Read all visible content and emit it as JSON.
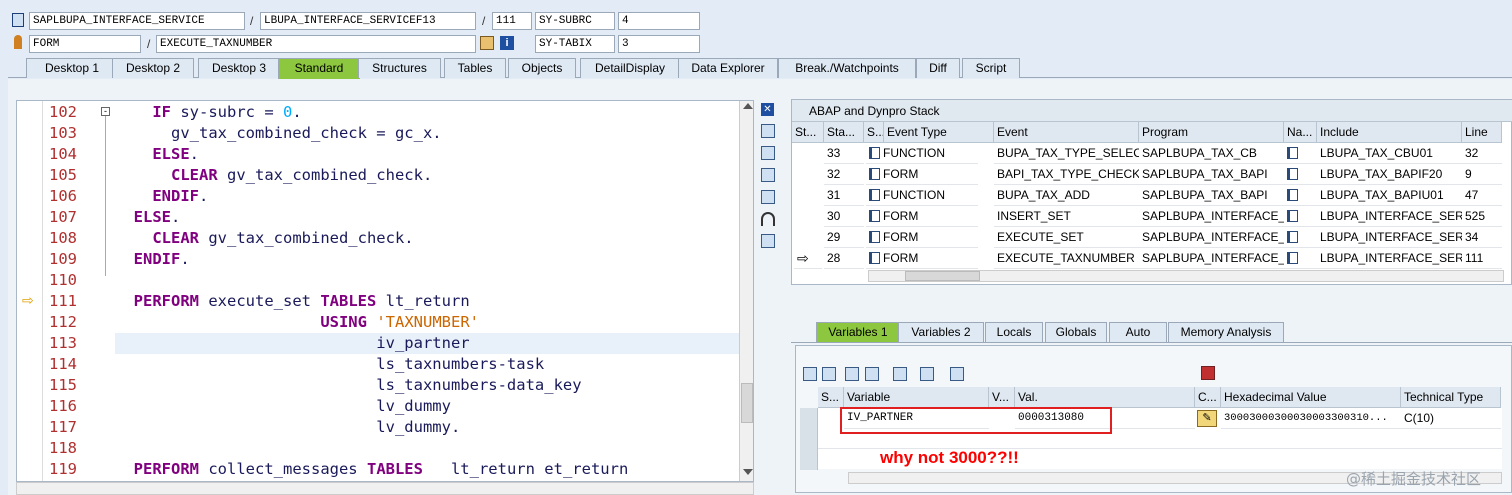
{
  "header": {
    "program_field": "SAPLBUPA_INTERFACE_SERVICE",
    "include_field": "LBUPA_INTERFACE_SERVICEF13",
    "line_field": "111",
    "sysvar1_name": "SY-SUBRC",
    "sysvar1_value": "4",
    "event_type_field": "FORM",
    "event_field": "EXECUTE_TAXNUMBER",
    "sysvar2_name": "SY-TABIX",
    "sysvar2_value": "3",
    "slash1": "/",
    "slash2": "/",
    "slash3": "/"
  },
  "tabs": [
    "Desktop 1",
    "Desktop 2",
    "Desktop 3",
    "Standard",
    "Structures",
    "Tables",
    "Objects",
    "DetailDisplay",
    "Data Explorer",
    "Break./Watchpoints",
    "Diff",
    "Script"
  ],
  "code": {
    "line_numbers": [
      "102",
      "103",
      "104",
      "105",
      "106",
      "107",
      "108",
      "109",
      "110",
      "111",
      "112",
      "113",
      "114",
      "115",
      "116",
      "117",
      "118",
      "119"
    ],
    "current_line_marker": "⇨"
  },
  "stack": {
    "title": "ABAP and Dynpro Stack",
    "columns": [
      "St...",
      "Sta...",
      "S...",
      "Event Type",
      "Event",
      "Program",
      "Na...",
      "Include",
      "Line"
    ],
    "rows": [
      {
        "stack": "33",
        "event_type": "FUNCTION",
        "event": "BUPA_TAX_TYPE_SELEC...",
        "program": "SAPLBUPA_TAX_CB",
        "include": "LBUPA_TAX_CBU01",
        "line": "32"
      },
      {
        "stack": "32",
        "event_type": "FORM",
        "event": "BAPI_TAX_TYPE_CHECK",
        "program": "SAPLBUPA_TAX_BAPI",
        "include": "LBUPA_TAX_BAPIF20",
        "line": "9"
      },
      {
        "stack": "31",
        "event_type": "FUNCTION",
        "event": "BUPA_TAX_ADD",
        "program": "SAPLBUPA_TAX_BAPI",
        "include": "LBUPA_TAX_BAPIU01",
        "line": "47"
      },
      {
        "stack": "30",
        "event_type": "FORM",
        "event": "INSERT_SET",
        "program": "SAPLBUPA_INTERFACE_...",
        "include": "LBUPA_INTERFACE_SER...",
        "line": "525"
      },
      {
        "stack": "29",
        "event_type": "FORM",
        "event": "EXECUTE_SET",
        "program": "SAPLBUPA_INTERFACE_...",
        "include": "LBUPA_INTERFACE_SER...",
        "line": "34"
      },
      {
        "stack": "28",
        "event_type": "FORM",
        "event": "EXECUTE_TAXNUMBER",
        "program": "SAPLBUPA_INTERFACE_...",
        "include": "LBUPA_INTERFACE_SER...",
        "line": "111",
        "current": true
      }
    ]
  },
  "var_tabs": [
    "Variables 1",
    "Variables 2",
    "Locals",
    "Globals",
    "Auto",
    "Memory Analysis"
  ],
  "variables": {
    "columns": [
      "S...",
      "Variable",
      "V...",
      "Val.",
      "C...",
      "Hexadecimal Value",
      "Technical Type"
    ],
    "rows": [
      {
        "name": "IV_PARTNER",
        "value": "0000313080",
        "hex": "30003000300030003300310...",
        "type": "C(10)"
      }
    ]
  },
  "annotation": "why not 3000??!!",
  "watermark": "@稀土掘金技术社区",
  "colors": {
    "active_tab": "#8dc63f",
    "annotation": "#ff0000",
    "highlight_box": "#e02020"
  }
}
